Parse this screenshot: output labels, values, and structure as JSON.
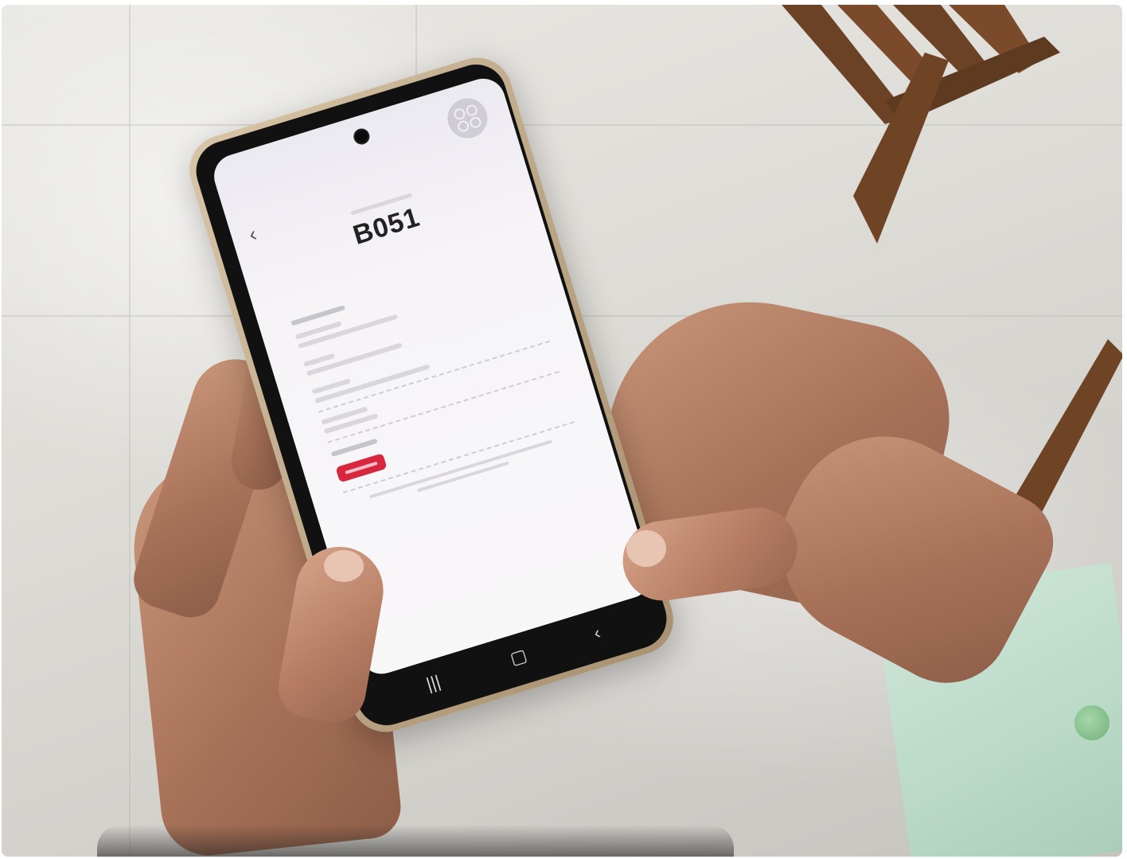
{
  "scene": {
    "description_free": true,
    "accent_colors": {
      "status_red": "#d8263f",
      "phone_case": "#bba685",
      "sleeve_green": "#b9d9c6"
    }
  },
  "phone_screen": {
    "back_icon": "chevron-left-icon",
    "logo_icon": "circle-logo-icon",
    "queue_number": "B051",
    "nav_icons": [
      "recents-icon",
      "home-icon",
      "back-icon"
    ]
  }
}
